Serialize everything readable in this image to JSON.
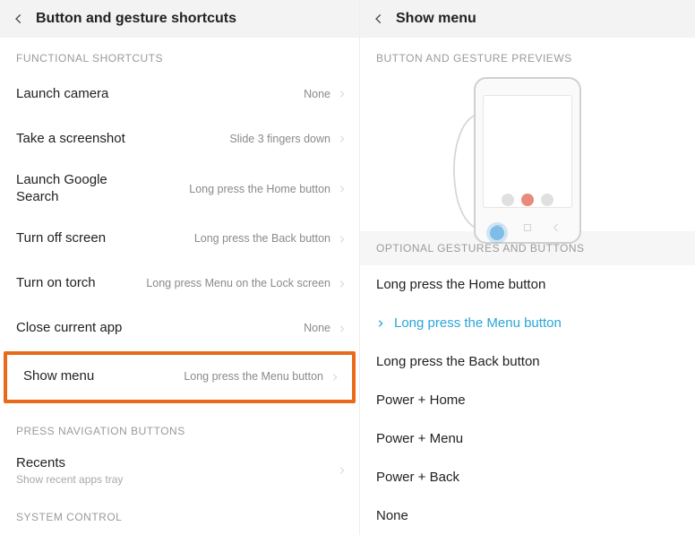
{
  "left": {
    "title": "Button and gesture shortcuts",
    "sections": {
      "functional": {
        "header": "FUNCTIONAL SHORTCUTS",
        "items": [
          {
            "label": "Launch camera",
            "value": "None"
          },
          {
            "label": "Take a screenshot",
            "value": "Slide 3 fingers down"
          },
          {
            "label": "Launch Google Search",
            "value": "Long press the Home button"
          },
          {
            "label": "Turn off screen",
            "value": "Long press the Back button"
          },
          {
            "label": "Turn on torch",
            "value": "Long press Menu on the Lock screen"
          },
          {
            "label": "Close current app",
            "value": "None"
          },
          {
            "label": "Show menu",
            "value": "Long press the Menu button",
            "highlighted": true
          }
        ]
      },
      "nav": {
        "header": "PRESS NAVIGATION BUTTONS",
        "items": [
          {
            "label": "Recents",
            "sub": "Show recent apps tray"
          }
        ]
      },
      "system": {
        "header": "SYSTEM CONTROL"
      }
    }
  },
  "right": {
    "title": "Show menu",
    "preview_header": "BUTTON AND GESTURE PREVIEWS",
    "options_header": "OPTIONAL GESTURES AND BUTTONS",
    "options": [
      {
        "label": "Long press the Home button",
        "selected": false
      },
      {
        "label": "Long press the Menu button",
        "selected": true
      },
      {
        "label": "Long press the Back button",
        "selected": false
      },
      {
        "label": "Power + Home",
        "selected": false
      },
      {
        "label": "Power + Menu",
        "selected": false
      },
      {
        "label": "Power + Back",
        "selected": false
      },
      {
        "label": "None",
        "selected": false
      }
    ]
  }
}
